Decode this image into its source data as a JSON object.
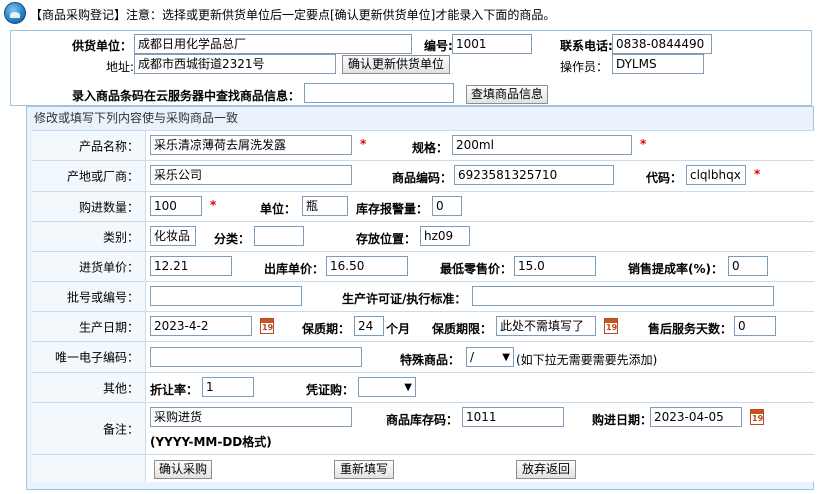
{
  "header": {
    "notice": "【商品采购登记】注意：选择或更新供货单位后一定要点[确认更新供货单位]才能录入下面的商品。"
  },
  "supplier": {
    "name_label": "供货单位：",
    "name_value": "成都日用化学品总厂",
    "code_label": "编号:",
    "code_value": "1001",
    "phone_label": "联系电话:",
    "phone_value": "0838-0844490",
    "address_label": "地址:",
    "address_value": "成都市西城街道2321号",
    "confirm_button": "确认更新供货单位",
    "operator_label": "操作员：",
    "operator_value": "DYLMS"
  },
  "barcode": {
    "label": "录入商品条码在云服务器中查找商品信息：",
    "value": "",
    "button": "查填商品信息"
  },
  "section_title": "修改或填写下列内容使与采购商品一致",
  "form": {
    "product_name_label": "产品名称：",
    "product_name": "采乐清凉薄荷去屑洗发露",
    "spec_label": "规格：",
    "spec": "200ml",
    "maker_label": "产地或厂商：",
    "maker": "采乐公司",
    "product_code_label": "商品编码：",
    "product_code": "6923581325710",
    "short_code_label": "代码：",
    "short_code": "clqlbhqx",
    "qty_label": "购进数量：",
    "qty": "100",
    "unit_label": "单位：",
    "unit": "瓶",
    "alarm_label": "库存报警量：",
    "alarm": "0",
    "category_label": "类别：",
    "category": "化妆品",
    "subcategory_label": "分类：",
    "subcategory": "",
    "location_label": "存放位置：",
    "location": "hz09",
    "price_label": "进货单价：",
    "price": "12.21",
    "out_price_label": "出库单价：",
    "out_price": "16.50",
    "min_price_label": "最低零售价：",
    "min_price": "15.0",
    "commission_label": "销售提成率(%)：",
    "commission": "0",
    "batch_label": "批号或编号：",
    "batch": "",
    "license_label": "生产许可证/执行标准：",
    "license": "",
    "mfg_date_label": "生产日期：",
    "mfg_date": "2023-4-2",
    "shelf_label": "保质期：",
    "shelf": "24",
    "shelf_unit": "个月",
    "shelf_limit_label": "保质期限：",
    "shelf_limit": "此处不需填写了",
    "service_days_label": "售后服务天数：",
    "service_days": "0",
    "ecode_label": "唯一电子编码：",
    "ecode": "",
    "special_label": "特殊商品：",
    "special_value": "/",
    "special_hint": "(如下拉无需要需要先添加)",
    "other_label": "其他：",
    "discount_label": "折让率：",
    "discount": "1",
    "voucher_label": "凭证购：",
    "voucher_value": "",
    "note_label": "备注：",
    "note": "采购进货",
    "note_format": "(YYYY-MM-DD格式)",
    "stock_code_label": "商品库存码：",
    "stock_code": "1011",
    "purchase_date_label": "购进日期：",
    "purchase_date": "2023-04-05"
  },
  "actions": {
    "confirm": "确认采购",
    "reset": "重新填写",
    "cancel": "放弃返回"
  },
  "colors": {
    "panel_border": "#9fc3e0",
    "section_bg": "#eaf2fb",
    "required_star": "#e00000"
  }
}
